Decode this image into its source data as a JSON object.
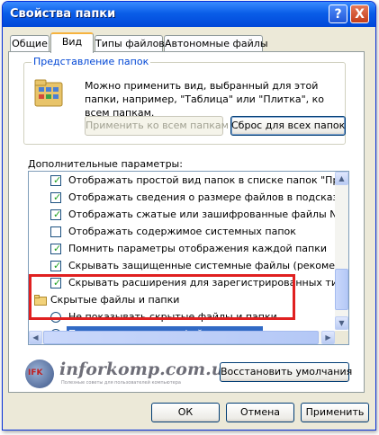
{
  "window": {
    "title": "Свойства папки"
  },
  "titlebar_buttons": {
    "help": "?",
    "close": "X"
  },
  "tabs": [
    {
      "label": "Общие",
      "active": false
    },
    {
      "label": "Вид",
      "active": true
    },
    {
      "label": "Типы файлов",
      "active": false
    },
    {
      "label": "Автономные файлы",
      "active": false
    }
  ],
  "folder_view": {
    "legend": "Представление папок",
    "description": "Можно применить вид, выбранный для этой папки, например, \"Таблица\" или \"Плитка\", ко всем папкам.",
    "apply_all_label": "Применить ко всем папкам",
    "reset_all_label": "Сброс для всех папок"
  },
  "advanced": {
    "label": "Дополнительные параметры:",
    "items": [
      {
        "kind": "checkbox",
        "checked": true,
        "text": "Отображать простой вид папок в списке папок \"Проводни"
      },
      {
        "kind": "checkbox",
        "checked": true,
        "text": "Отображать сведения о размере файлов в подсказках па"
      },
      {
        "kind": "checkbox",
        "checked": true,
        "text": "Отображать сжатые или зашифрованные файлы NTFS др"
      },
      {
        "kind": "checkbox",
        "checked": false,
        "text": "Отображать содержимое системных папок"
      },
      {
        "kind": "checkbox",
        "checked": true,
        "text": "Помнить параметры отображения каждой папки"
      },
      {
        "kind": "checkbox",
        "checked": true,
        "text": "Скрывать защищенные системные файлы (рекомендуете"
      },
      {
        "kind": "checkbox",
        "checked": true,
        "text": "Скрывать расширения для зарегистрированных типов фа"
      },
      {
        "kind": "folder",
        "text": "Скрытые файлы и папки"
      },
      {
        "kind": "radio",
        "checked": false,
        "text": "Не показывать скрытые файлы и папки"
      },
      {
        "kind": "radio",
        "checked": true,
        "text": "Показывать скрытые файлы и папки"
      }
    ],
    "restore_defaults_label": "Восстановить умолчания"
  },
  "watermark": {
    "logo_text": "IFK",
    "site": "inforkomp.com.ua",
    "tagline": "Полезные советы для пользователей компьютера"
  },
  "footer": {
    "ok_label": "ОК",
    "cancel_label": "Отмена",
    "apply_label": "Применить"
  },
  "colors": {
    "titlebar": "#0054e3",
    "selection": "#316ac5",
    "highlight_box": "#e02020",
    "check": "#21a121"
  }
}
